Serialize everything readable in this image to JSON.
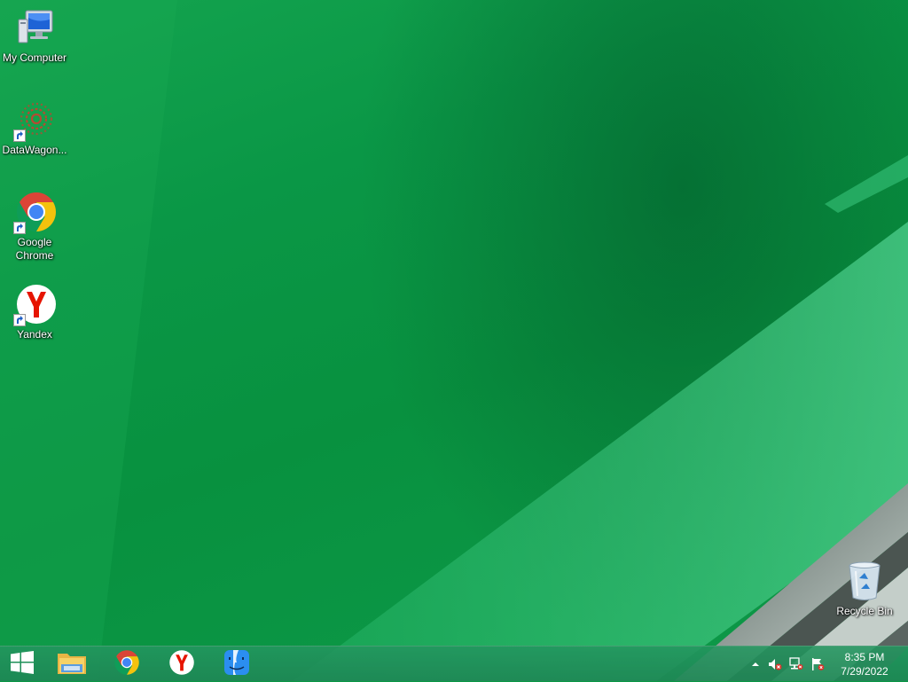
{
  "desktop": {
    "icons": [
      {
        "label": "My Computer",
        "icon": "computer-icon"
      },
      {
        "label": "DataWagon...",
        "icon": "datawagon-icon"
      },
      {
        "label": "Google Chrome",
        "icon": "chrome-icon"
      },
      {
        "label": "Yandex",
        "icon": "yandex-icon"
      },
      {
        "label": "Recycle Bin",
        "icon": "recycle-bin-icon"
      }
    ]
  },
  "taskbar": {
    "start_icon": "windows-logo-icon",
    "pinned": [
      {
        "icon": "file-explorer-icon"
      },
      {
        "icon": "chrome-icon"
      },
      {
        "icon": "yandex-icon"
      },
      {
        "icon": "finder-icon"
      }
    ],
    "tray": {
      "icons": [
        "chevron-up-icon",
        "volume-muted-icon",
        "network-error-icon",
        "action-center-flag-icon"
      ],
      "time": "8:35 PM",
      "date": "7/29/2022"
    }
  },
  "colors": {
    "wallpaper": "#0b9846",
    "taskbar": "#23965f",
    "chrome_red": "#db4437",
    "chrome_yellow": "#f4c20d",
    "chrome_green": "#0f9d58",
    "chrome_blue": "#4285f4",
    "yandex_red": "#e61400"
  }
}
